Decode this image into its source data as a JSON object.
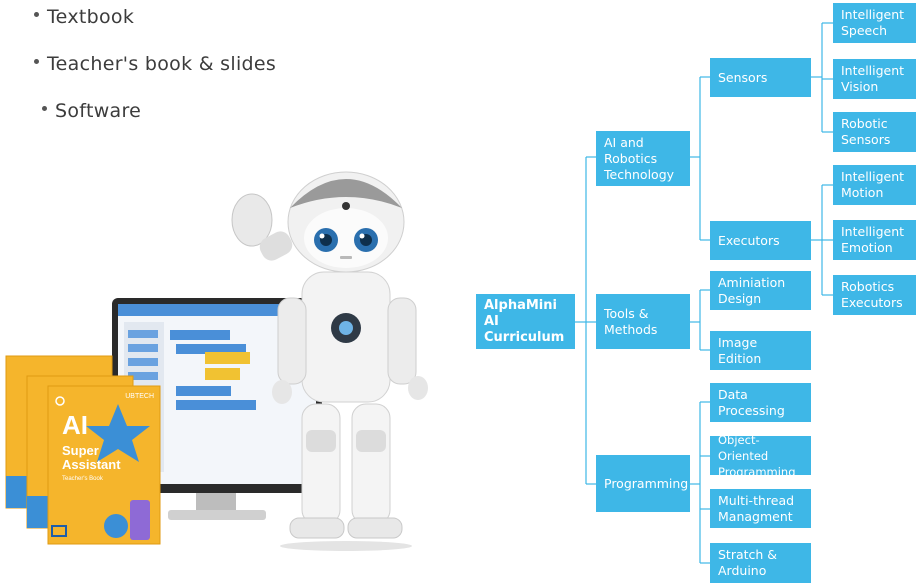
{
  "bullets": [
    "Textbook",
    "Teacher's book & slides",
    "Software"
  ],
  "colors": {
    "node": "#3eb7e7",
    "line": "#3eb7e7",
    "book": "#f5b52c",
    "screen": "#4a8fd8"
  },
  "tree": {
    "root": "AlphaMini AI\nCurriculum",
    "branches": [
      {
        "label": "AI and\nRobotics\nTechnology",
        "children": [
          {
            "label": "Sensors",
            "children": [
              "Intelligent\nSpeech",
              "Intelligent\nVision",
              "Robotic\nSensors"
            ]
          },
          {
            "label": "Executors",
            "children": [
              "Intelligent\nMotion",
              "Intelligent\nEmotion",
              "Robotics\nExecutors"
            ]
          }
        ]
      },
      {
        "label": "Tools &\nMethods",
        "children": [
          "Aminiation\nDesign",
          "Image\nEdition"
        ]
      },
      {
        "label": "Programming",
        "children": [
          "Data\nProcessing",
          "Object-Oriented\nProgramming",
          "Multi-thread\nManagment",
          "Stratch &\nArduino"
        ]
      }
    ]
  },
  "books": {
    "brand": "UBTECH",
    "title": "AI",
    "subtitle": "Super\nAssistant",
    "caption": "Teacher's Book"
  }
}
